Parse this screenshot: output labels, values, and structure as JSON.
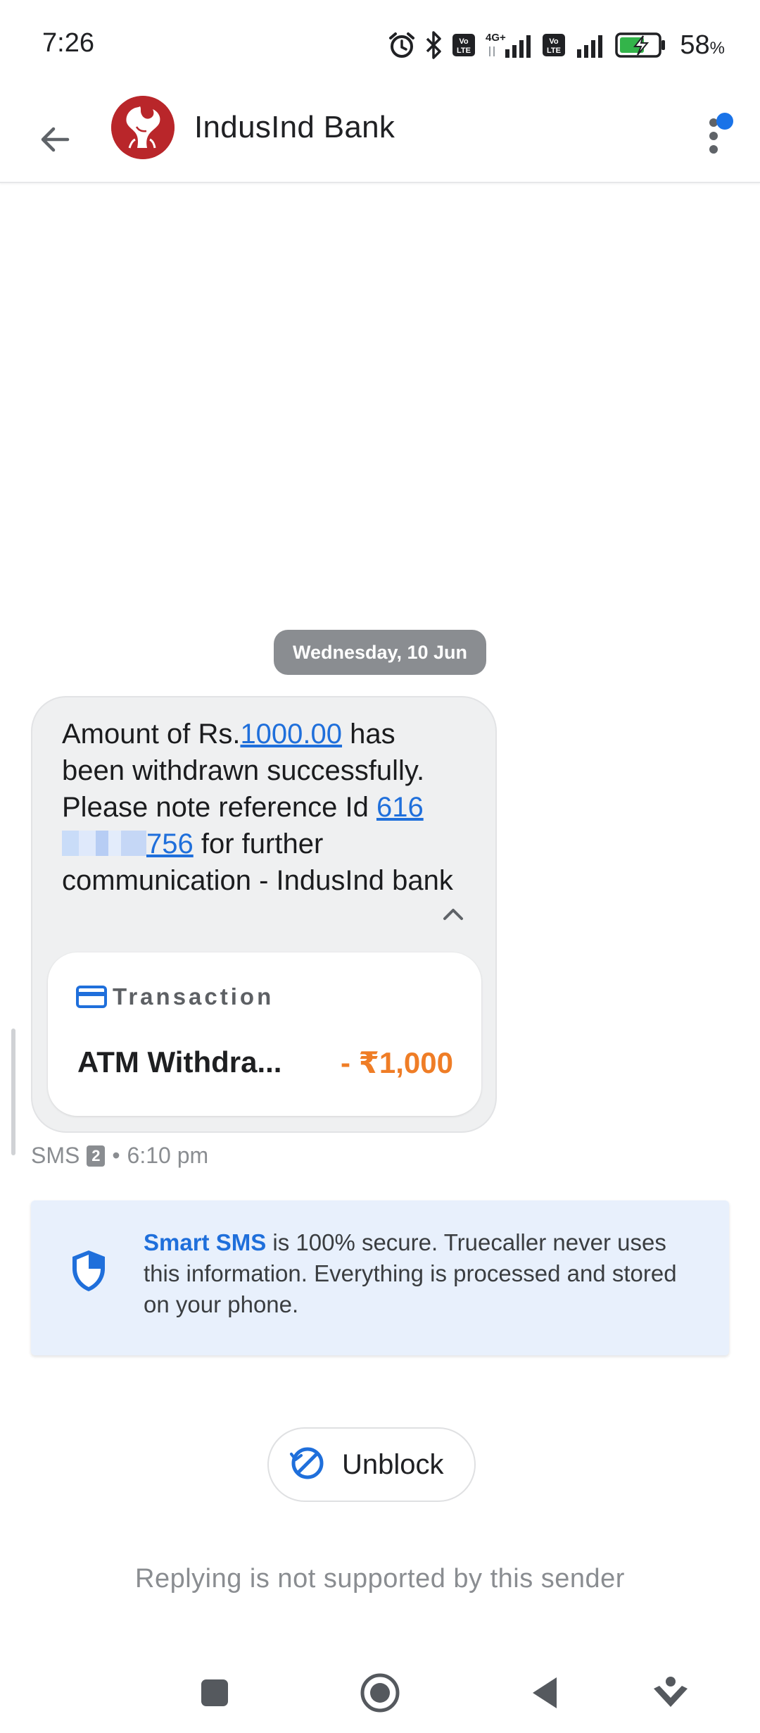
{
  "status_bar": {
    "time": "7:26",
    "battery_percent": "58",
    "battery_unit": "%",
    "network_1": "4G+",
    "icons": [
      "alarm-icon",
      "bluetooth-icon",
      "volte-icon",
      "signal-icon",
      "volte-icon",
      "signal-icon",
      "battery-charging-icon"
    ]
  },
  "header": {
    "title": "IndusInd Bank",
    "back_icon": "arrow-left-icon",
    "more_icon": "more-vertical-icon",
    "notification_dot_color": "#1a73e8"
  },
  "conversation": {
    "date_chip": "Wednesday, 10 Jun",
    "message": {
      "part1": "Amount of Rs.",
      "amount_link": "1000.00",
      "part2": " has been withdrawn successfully. Please note reference Id ",
      "ref_prefix": "616",
      "ref_suffix": "756",
      "part3": " for further communication - IndusInd bank",
      "collapse_icon": "chevron-up-icon"
    },
    "transaction_card": {
      "label": "Transaction",
      "description": "ATM Withdra...",
      "amount": "- ₹1,000",
      "amount_color": "#ef7d26"
    },
    "meta": {
      "channel": "SMS",
      "sim": "2",
      "separator": "•",
      "time": "6:10 pm"
    }
  },
  "info_card": {
    "highlight": "Smart SMS",
    "text": " is 100% secure. Truecaller never uses this information. Everything is processed and stored on your phone.",
    "icon": "shield-icon"
  },
  "unblock_button": {
    "label": "Unblock",
    "icon": "unblock-icon"
  },
  "reply_note": "Replying is not supported by this sender",
  "nav_bar": {
    "items": [
      "recents-icon",
      "home-icon",
      "back-icon",
      "assistant-icon"
    ]
  },
  "colors": {
    "accent": "#1f6fdb",
    "bubble": "#eff0f1",
    "info_bg": "#e8f0fc"
  }
}
